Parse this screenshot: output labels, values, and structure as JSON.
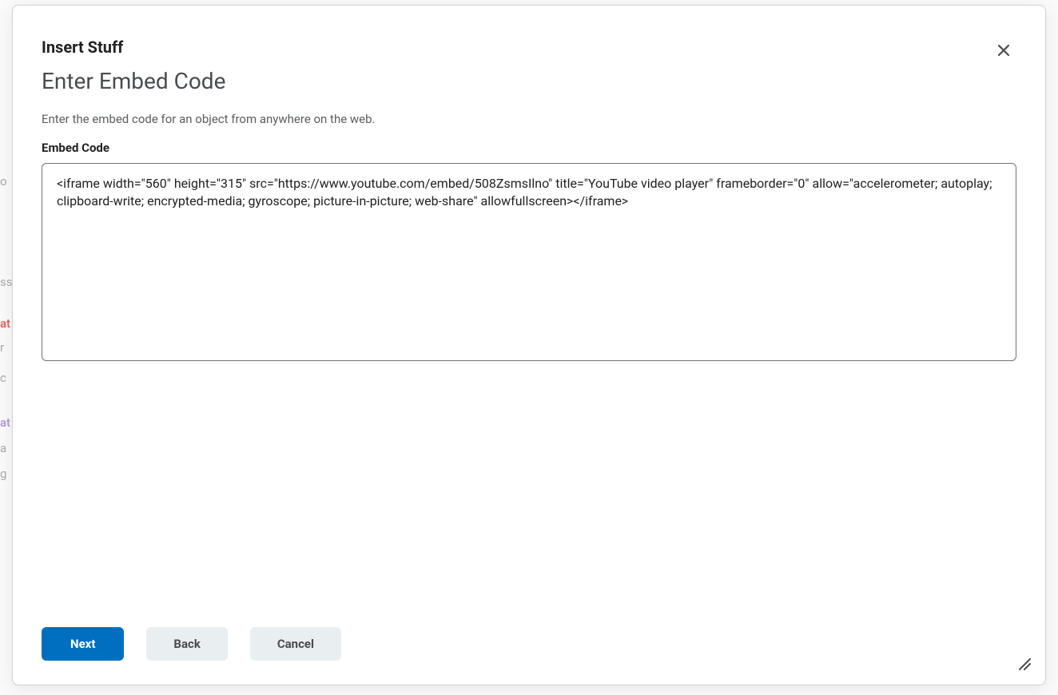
{
  "backdrop": {
    "t1": "o",
    "t2": "ss",
    "t3": "at",
    "t4": "r",
    "t5": "c",
    "t6": "at",
    "t7": "a",
    "t8": "g"
  },
  "modal": {
    "title_small": "Insert Stuff",
    "title_large": "Enter Embed Code",
    "description": "Enter the embed code for an object from anywhere on the web.",
    "field_label": "Embed Code",
    "textarea_value": "<iframe width=\"560\" height=\"315\" src=\"https://www.youtube.com/embed/508ZsmsIlno\" title=\"YouTube video player\" frameborder=\"0\" allow=\"accelerometer; autoplay; clipboard-write; encrypted-media; gyroscope; picture-in-picture; web-share\" allowfullscreen></iframe>",
    "buttons": {
      "next": "Next",
      "back": "Back",
      "cancel": "Cancel"
    }
  }
}
